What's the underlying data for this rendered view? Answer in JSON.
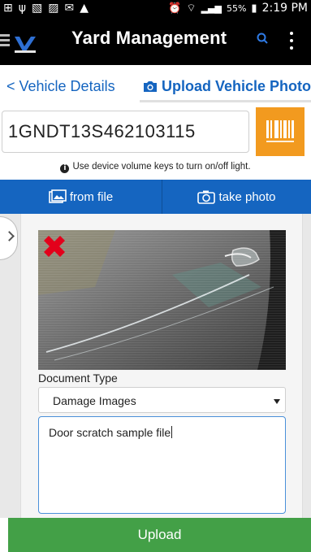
{
  "status_bar": {
    "battery": "55%",
    "time": "2:19 PM",
    "icons": [
      "add-box-icon",
      "usb-icon",
      "no-sim-icon",
      "image-icon",
      "mail-icon",
      "warning-icon",
      "alarm-icon",
      "wifi-icon",
      "signal-icon",
      "battery-charging-icon"
    ]
  },
  "app_bar": {
    "title": "Yard Management",
    "icons": [
      "hamburger-icon",
      "app-logo",
      "search-icon",
      "more-vert-icon"
    ]
  },
  "tabs": {
    "back_label": "< Vehicle Details",
    "upload_label": "Upload Vehicle Photos"
  },
  "vin": {
    "value": "1GNDT13S462103115"
  },
  "hint": {
    "text": "Use device volume keys to turn on/off light."
  },
  "actions": {
    "from_file": "from file",
    "take_photo": "take photo"
  },
  "document": {
    "type_label": "Document Type",
    "type_value": "Damage Images",
    "description": "Door scratch sample file"
  },
  "upload_label": "Upload",
  "colors": {
    "blue": "#1565c0",
    "orange": "#f29a1f",
    "green": "#43a047",
    "delete_red": "#e3001b"
  }
}
